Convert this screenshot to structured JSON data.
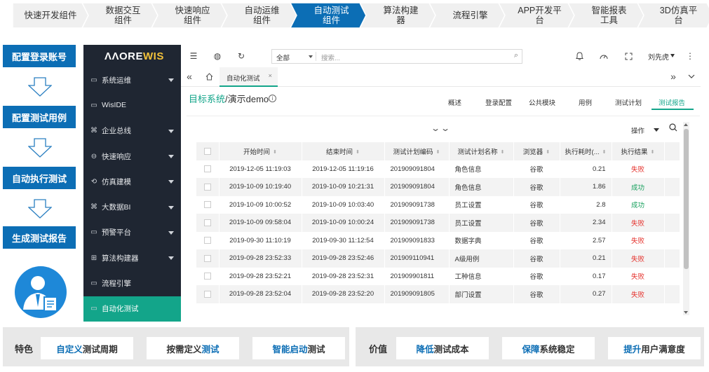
{
  "process_steps": [
    {
      "label": "快速开发组件",
      "active": false
    },
    {
      "label": "数据交互\n组件",
      "active": false
    },
    {
      "label": "快速响应\n组件",
      "active": false
    },
    {
      "label": "自动运维\n组件",
      "active": false
    },
    {
      "label": "自动测试\n组件",
      "active": true
    },
    {
      "label": "算法构建\n器",
      "active": false
    },
    {
      "label": "流程引擎",
      "active": false
    },
    {
      "label": "APP开发平\n台",
      "active": false
    },
    {
      "label": "智能报表\n工具",
      "active": false
    },
    {
      "label": "3D仿真平\n台",
      "active": false
    }
  ],
  "flow": [
    "配置登录账号",
    "配置测试用例",
    "自动执行测试",
    "生成测试报告"
  ],
  "app": {
    "logo_main": "MOREWIS",
    "logo_text_a": "ΛΛORE",
    "logo_text_b": "WIS",
    "sidebar": [
      {
        "label": "系统运维",
        "icon": "monitor-icon",
        "glyph": "▭",
        "caret": true
      },
      {
        "label": "WisIDE",
        "icon": "ide-icon",
        "glyph": "▭",
        "caret": false
      },
      {
        "label": "企业总线",
        "icon": "bus-icon",
        "glyph": "⌘",
        "caret": true
      },
      {
        "label": "快速响应",
        "icon": "response-icon",
        "glyph": "⊖",
        "caret": true
      },
      {
        "label": "仿真建模",
        "icon": "model-icon",
        "glyph": "⟲",
        "caret": true
      },
      {
        "label": "大数据BI",
        "icon": "bi-icon",
        "glyph": "⌘",
        "caret": true
      },
      {
        "label": "预警平台",
        "icon": "alert-icon",
        "glyph": "▭",
        "caret": true
      },
      {
        "label": "算法构建器",
        "icon": "algorithm-icon",
        "glyph": "⊞",
        "caret": true
      },
      {
        "label": "流程引擎",
        "icon": "flow-icon",
        "glyph": "▭",
        "caret": false
      },
      {
        "label": "自动化测试",
        "icon": "test-icon",
        "glyph": "▭",
        "caret": false,
        "active": true
      }
    ],
    "search": {
      "scope": "全部",
      "placeholder": "搜索..."
    },
    "user": "刘先虎",
    "open_tab": "自动化测试",
    "breadcrumb": {
      "link": "目标系统",
      "sep": "/",
      "current": "演示demo"
    },
    "right_tabs": [
      {
        "label": "概述",
        "active": false
      },
      {
        "label": "登录配置",
        "active": false
      },
      {
        "label": "公共模块",
        "active": false
      },
      {
        "label": "用例",
        "active": false
      },
      {
        "label": "测试计划",
        "active": false
      },
      {
        "label": "测试报告",
        "active": true
      }
    ],
    "toolbar": {
      "operation": "操作"
    },
    "table": {
      "columns": [
        "开始时间",
        "结束时间",
        "测试计划编码",
        "测试计划名称",
        "浏览器",
        "执行耗时(...",
        "执行结果"
      ],
      "rows": [
        {
          "start": "2019-12-05 11:19:03",
          "end": "2019-12-05 11:19:16",
          "code": "201909091804",
          "name": "角色信息",
          "browser": "谷歌",
          "duration": "0.21",
          "result": "失败"
        },
        {
          "start": "2019-10-09 10:19:40",
          "end": "2019-10-09 10:21:31",
          "code": "201909091804",
          "name": "角色信息",
          "browser": "谷歌",
          "duration": "1.86",
          "result": "成功"
        },
        {
          "start": "2019-10-09 10:00:52",
          "end": "2019-10-09 10:03:40",
          "code": "201909091738",
          "name": "员工设置",
          "browser": "谷歌",
          "duration": "2.8",
          "result": "成功"
        },
        {
          "start": "2019-10-09 09:58:04",
          "end": "2019-10-09 10:00:24",
          "code": "201909091738",
          "name": "员工设置",
          "browser": "谷歌",
          "duration": "2.34",
          "result": "失败"
        },
        {
          "start": "2019-09-30 11:10:19",
          "end": "2019-09-30 11:12:54",
          "code": "201909091833",
          "name": "数据字典",
          "browser": "谷歌",
          "duration": "2.57",
          "result": "失败"
        },
        {
          "start": "2019-09-28 23:52:33",
          "end": "2019-09-28 23:52:46",
          "code": "201909110941",
          "name": "A级用例",
          "browser": "谷歌",
          "duration": "0.21",
          "result": "失败"
        },
        {
          "start": "2019-09-28 23:52:21",
          "end": "2019-09-28 23:52:31",
          "code": "201909901811",
          "name": "工种信息",
          "browser": "谷歌",
          "duration": "0.17",
          "result": "失败"
        },
        {
          "start": "2019-09-28 23:52:04",
          "end": "2019-09-28 23:52:20",
          "code": "201909091805",
          "name": "部门设置",
          "browser": "谷歌",
          "duration": "0.27",
          "result": "失败"
        }
      ]
    }
  },
  "features": {
    "title": "特色",
    "cards": [
      {
        "hl": "自定义",
        "rest": "测试周期",
        "hl_first": true
      },
      {
        "pre": "按需定义",
        "hl": "测试",
        "hl_first": false
      },
      {
        "hl": "智能启动",
        "rest": "测试",
        "hl_first": true
      }
    ]
  },
  "values": {
    "title": "价值",
    "cards": [
      {
        "hl": "降低",
        "rest": "测试成本"
      },
      {
        "hl": "保障",
        "rest": "系统稳定"
      },
      {
        "hl": "提升",
        "rest": "用户满意度"
      }
    ]
  },
  "colors": {
    "brand_blue": "#0c6eb5",
    "accent_green": "#13a58a",
    "fail_red": "#e5322d",
    "ok_green": "#17a05d",
    "sidebar_bg": "#1f2632"
  }
}
